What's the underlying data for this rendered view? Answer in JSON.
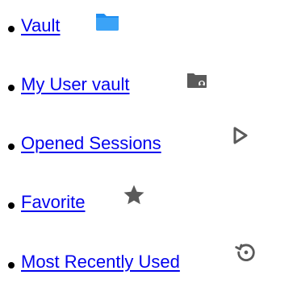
{
  "nav": {
    "items": [
      {
        "label": "Vault",
        "icon": "folder-icon"
      },
      {
        "label": "My User vault",
        "icon": "user-vault-icon"
      },
      {
        "label": "Opened Sessions",
        "icon": "play-icon"
      },
      {
        "label": "Favorite",
        "icon": "star-icon"
      },
      {
        "label": "Most Recently Used",
        "icon": "history-icon"
      }
    ]
  },
  "colors": {
    "link": "#0000ee",
    "folder_blue": "#1f8ef1",
    "icon_gray": "#5a5a5a"
  }
}
